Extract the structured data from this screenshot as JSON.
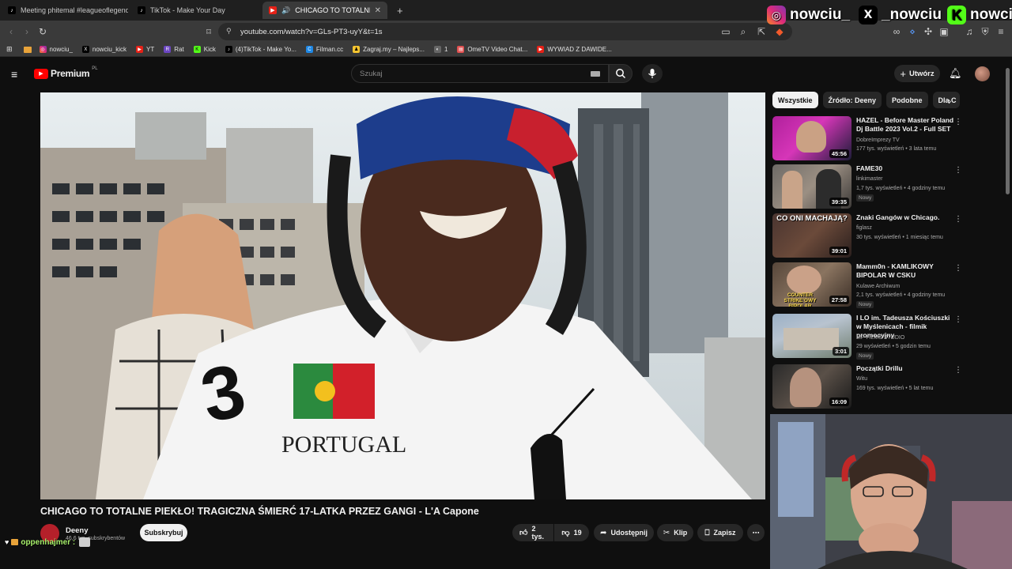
{
  "browser": {
    "tabs": [
      {
        "title": "Meeting phitemal #leagueoflegends",
        "active": false
      },
      {
        "title": "TikTok - Make Your Day",
        "active": false
      },
      {
        "title": "CHICAGO TO TOTALNE PIEKŁO",
        "active": true
      }
    ],
    "new_tab_label": "+",
    "url": "youtube.com/watch?v=GLs-PT3-uyY&t=1s",
    "bookmarks": [
      "nowciu_",
      "nowciu_kick",
      "YT",
      "Rat",
      "Kick",
      "(4)TikTok - Make Yo...",
      "Filman.cc",
      "Zagraj.my – Najleps...",
      "1",
      "OmeTV Video Chat...",
      "WYWIAD Z DAWIDE..."
    ]
  },
  "overlay": {
    "handles": [
      "nowciu_",
      "_nowciu",
      "nowciu"
    ],
    "chat_user": "oppenhajmer :"
  },
  "youtube": {
    "logo_text": "Premium",
    "logo_region": "PL",
    "search_placeholder": "Szukaj",
    "create_label": "Utwórz",
    "video_title": "CHICAGO TO TOTALNE PIEKŁO! TRAGICZNA ŚMIERĆ 17-LATKA PRZEZ GANGI - L'A Capone",
    "channel_name": "Deeny",
    "subscribers": "46,6 tys. subskrybentów",
    "subscribe_label": "Subskrybuj",
    "likes": "2 tys.",
    "dislikes": "19",
    "share_label": "Udostępnij",
    "clip_label": "Klip",
    "save_label": "Zapisz",
    "chips": [
      "Wszystkie",
      "Źródło: Deeny",
      "Podobne",
      "Dla C"
    ],
    "recommendations": [
      {
        "title": "HAZEL - Before Master Poland Dj Battle 2023 Vol.2 - Full SET",
        "channel": "DobreImprezy TV",
        "stats": "177 tys. wyświetleń • 3 lata temu",
        "duration": "45:56",
        "badge": ""
      },
      {
        "title": "FAME30",
        "channel": "linkimaster",
        "stats": "1,7 tys. wyświetleń • 4 godziny temu",
        "duration": "39:35",
        "badge": "Nowy"
      },
      {
        "title": "Znaki Gangów w Chicago.",
        "channel": "figlasz",
        "stats": "30 tys. wyświetleń • 1 miesiąc temu",
        "duration": "39:01",
        "badge": ""
      },
      {
        "title": "Mamm0n - KAMLIKOWY BIPOLAR W CSKU",
        "channel": "Kulawe Archiwum",
        "stats": "2,1 tys. wyświetleń • 4 godziny temu",
        "duration": "27:58",
        "badge": "Nowy"
      },
      {
        "title": "I LO im. Tadeusza Kościuszki w Myślenicach - filmik promocyjny",
        "channel": "MP FILMS STUDIO",
        "stats": "29 wyświetleń • 5 godzin temu",
        "duration": "3:01",
        "badge": "Nowy"
      },
      {
        "title": "Początki Drillu",
        "channel": "Witu",
        "stats": "169 tys. wyświetleń • 5 lat temu",
        "duration": "16:09",
        "badge": ""
      }
    ],
    "thumb_texts": [
      "CO ONI MACHAJĄ?",
      "COUNTER STRIKE'OWY BIPOLAR"
    ],
    "video_shirt_text": "PORTUGAL",
    "video_shirt_number": "3"
  }
}
